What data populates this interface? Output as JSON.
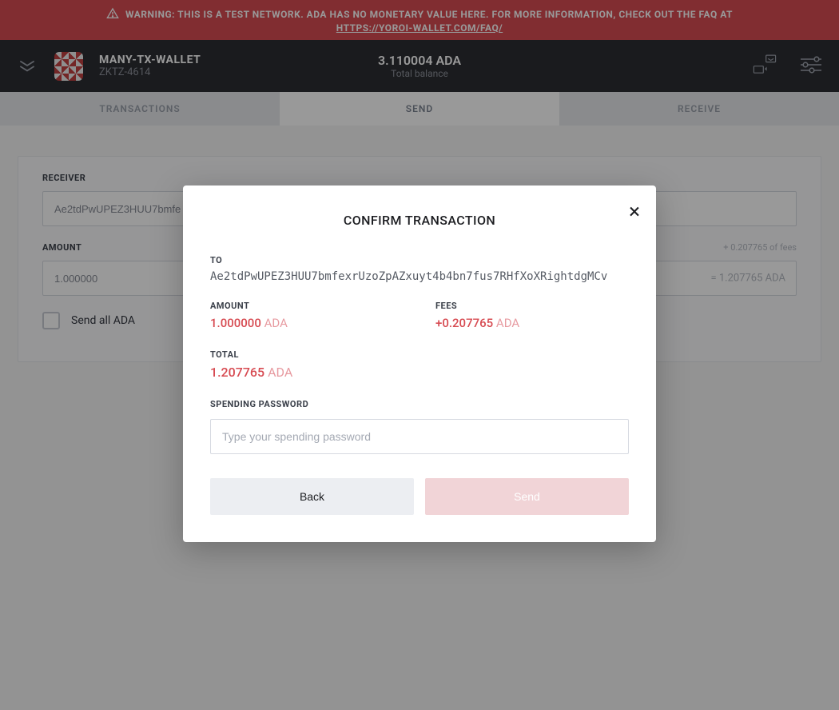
{
  "warning": {
    "text": "WARNING: THIS IS A TEST NETWORK. ADA HAS NO MONETARY VALUE HERE. FOR MORE INFORMATION, CHECK OUT THE FAQ AT",
    "link": "HTTPS://YOROI-WALLET.COM/FAQ/"
  },
  "wallet": {
    "name": "MANY-TX-WALLET",
    "subtitle": "ZKTZ-4614",
    "balance": "3.110004 ADA",
    "balance_label": "Total balance"
  },
  "tabs": {
    "transactions": "TRANSACTIONS",
    "send": "SEND",
    "receive": "RECEIVE"
  },
  "send_form": {
    "receiver_label": "RECEIVER",
    "receiver_value": "Ae2tdPwUPEZ3HUU7bmfe",
    "amount_label": "AMOUNT",
    "amount_value": "1.000000",
    "fees_note": "+ 0.207765 of fees",
    "equals": "= 1.207765 ADA",
    "send_all_label": "Send all ADA"
  },
  "modal": {
    "title": "CONFIRM TRANSACTION",
    "to_label": "TO",
    "to_value": "Ae2tdPwUPEZ3HUU7bmfexrUzoZpAZxuyt4b4bn7fus7RHfXoXRightdgMCv",
    "amount_label": "AMOUNT",
    "amount_value": "1.000000",
    "amount_unit": "ADA",
    "fees_label": "FEES",
    "fees_value": "+0.207765",
    "fees_unit": "ADA",
    "total_label": "TOTAL",
    "total_value": "1.207765",
    "total_unit": "ADA",
    "password_label": "SPENDING PASSWORD",
    "password_placeholder": "Type your spending password",
    "back": "Back",
    "send": "Send"
  }
}
